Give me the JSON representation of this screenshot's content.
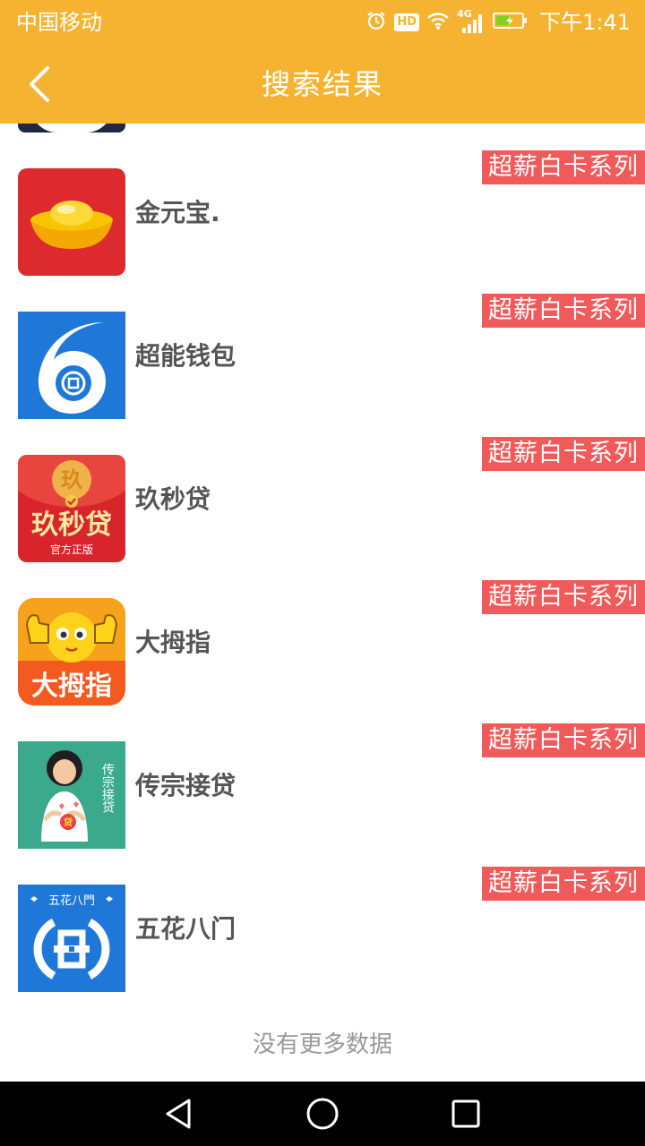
{
  "status_bar": {
    "carrier": "中国移动",
    "hd_badge": "HD",
    "network_badge": "4G",
    "time": "下午1:41",
    "icons": [
      "alarm-icon",
      "hd-icon",
      "wifi-icon",
      "signal-icon",
      "battery-charging-icon"
    ]
  },
  "header": {
    "title": "搜索结果",
    "back_icon": "chevron-left-icon",
    "background_color": "#f6b331"
  },
  "results": [
    {
      "name": "金元宝.",
      "tag": "超薪白卡系列"
    },
    {
      "name": "超能钱包",
      "tag": "超薪白卡系列"
    },
    {
      "name": "玖秒贷",
      "tag": "超薪白卡系列",
      "icon_text": "玖秒贷",
      "icon_subtext": "官方正版",
      "icon_coin_text": "玖"
    },
    {
      "name": "大拇指",
      "tag": "超薪白卡系列",
      "icon_text": "大拇指"
    },
    {
      "name": "传宗接贷",
      "tag": "超薪白卡系列",
      "icon_text": "传宗接贷",
      "icon_badge": "贷"
    },
    {
      "name": "五花八门",
      "tag": "超薪白卡系列",
      "icon_text": "五花八門"
    }
  ],
  "tag_color": "#f15a5a",
  "footer": {
    "no_more_text": "没有更多数据"
  },
  "system_nav": {
    "buttons": [
      "back-triangle-icon",
      "home-circle-icon",
      "recents-square-icon"
    ]
  }
}
